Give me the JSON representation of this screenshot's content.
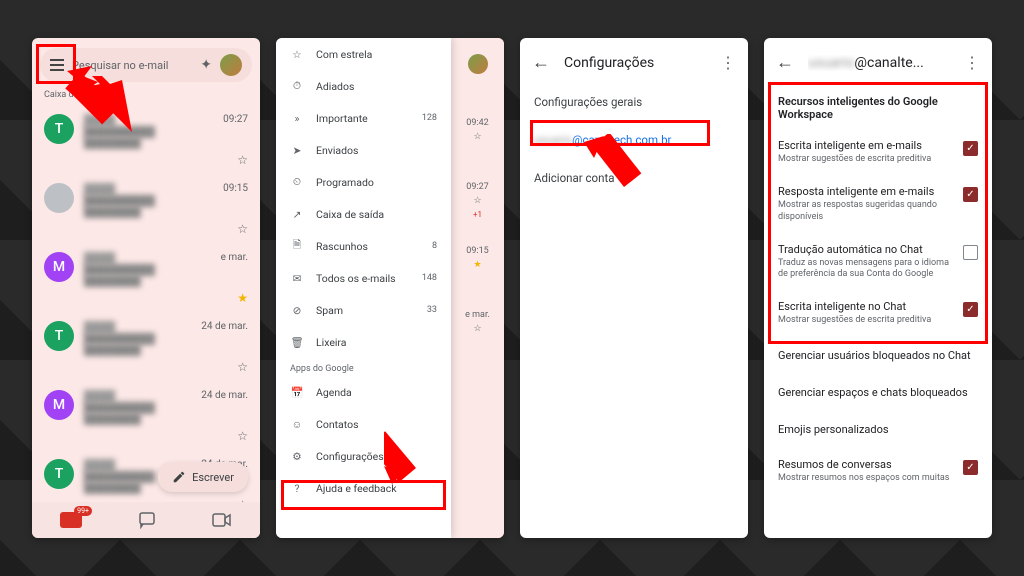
{
  "screen1": {
    "search_placeholder": "Pesquisar no e-mail",
    "inbox_label": "Caixa de entrada",
    "compose": "Escrever",
    "mail_badge": "99+",
    "rows": [
      {
        "letter": "T",
        "color": "#1ba261",
        "time": "09:27"
      },
      {
        "letter": "",
        "color": "#bdc1c6",
        "time": "09:15"
      },
      {
        "letter": "M",
        "color": "#a142f4",
        "time": "e mar."
      },
      {
        "letter": "T",
        "color": "#1ba261",
        "time": "24 de mar."
      },
      {
        "letter": "M",
        "color": "#a142f4",
        "time": "24 de mar."
      },
      {
        "letter": "T",
        "color": "#1ba261",
        "time": "24 de mar."
      }
    ]
  },
  "screen2": {
    "items": [
      {
        "icon": "☆",
        "label": "Com estrela",
        "count": ""
      },
      {
        "icon": "⏱",
        "label": "Adiados",
        "count": ""
      },
      {
        "icon": "»",
        "label": "Importante",
        "count": "128"
      },
      {
        "icon": "➤",
        "label": "Enviados",
        "count": ""
      },
      {
        "icon": "⏲",
        "label": "Programado",
        "count": ""
      },
      {
        "icon": "↗",
        "label": "Caixa de saída",
        "count": ""
      },
      {
        "icon": "🗎",
        "label": "Rascunhos",
        "count": "8"
      },
      {
        "icon": "✉",
        "label": "Todos os e-mails",
        "count": "148"
      },
      {
        "icon": "⊘",
        "label": "Spam",
        "count": "33"
      },
      {
        "icon": "🗑",
        "label": "Lixeira",
        "count": ""
      }
    ],
    "apps_header": "Apps do Google",
    "apps": [
      {
        "icon": "📅",
        "label": "Agenda"
      },
      {
        "icon": "☺",
        "label": "Contatos"
      },
      {
        "icon": "⚙",
        "label": "Configurações"
      },
      {
        "icon": "?",
        "label": "Ajuda e feedback"
      }
    ],
    "under_times": [
      "09:42",
      "09:27",
      "09:15",
      "e mar."
    ]
  },
  "screen3": {
    "title": "Configurações",
    "general": "Configurações gerais",
    "account": "@canaltech.com.br",
    "add": "Adicionar conta"
  },
  "screen4": {
    "title": "@canalte...",
    "section": "Recursos inteligentes do Google Workspace",
    "rows": [
      {
        "ttl": "Escrita inteligente em e-mails",
        "sub": "Mostrar sugestões de escrita preditiva",
        "on": true
      },
      {
        "ttl": "Resposta inteligente em e-mails",
        "sub": "Mostrar as respostas sugeridas quando disponíveis",
        "on": true
      },
      {
        "ttl": "Tradução automática no Chat",
        "sub": "Traduz as novas mensagens para o idioma de preferência da sua Conta do Google",
        "on": false
      },
      {
        "ttl": "Escrita inteligente no Chat",
        "sub": "Mostrar sugestões de escrita preditiva",
        "on": true
      }
    ],
    "plain": [
      "Gerenciar usuários bloqueados no Chat",
      "Gerenciar espaços e chats bloqueados",
      "Emojis personalizados"
    ],
    "last": {
      "ttl": "Resumos de conversas",
      "sub": "Mostrar resumos nos espaços com muitas",
      "on": true
    }
  }
}
